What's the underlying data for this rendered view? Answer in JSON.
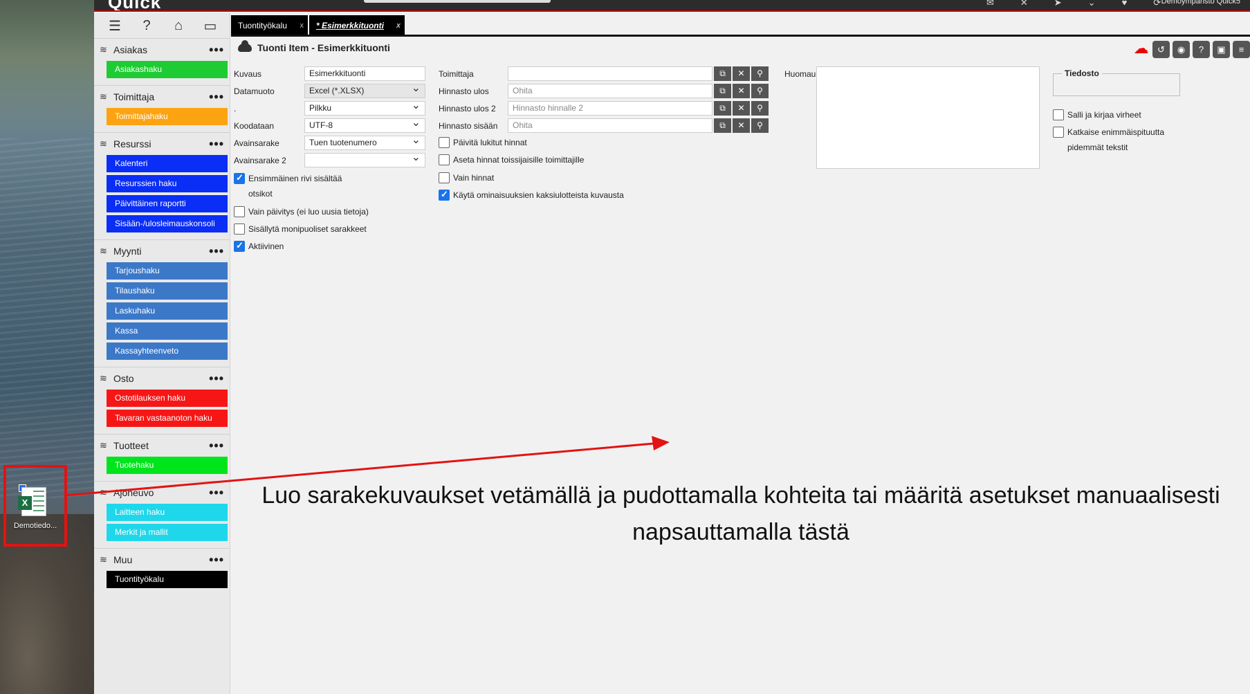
{
  "desktop": {
    "file_name": "Demotiedo..."
  },
  "topbar": {
    "logo": "Quick",
    "user": "Demoympäristö Quick5"
  },
  "nav": {
    "sections": [
      {
        "title": "Asiakas",
        "items": [
          {
            "label": "Asiakashaku",
            "color": "#1ecb32"
          }
        ]
      },
      {
        "title": "Toimittaja",
        "items": [
          {
            "label": "Toimittajahaku",
            "color": "#fca311"
          }
        ]
      },
      {
        "title": "Resurssi",
        "items": [
          {
            "label": "Kalenteri"
          },
          {
            "label": "Resurssien haku"
          },
          {
            "label": "Päivittäinen raportti"
          },
          {
            "label": "Sisään-/ulosleimauskonsoli"
          }
        ]
      },
      {
        "title": "Myynti",
        "items": [
          {
            "label": "Tarjoushaku"
          },
          {
            "label": "Tilaushaku"
          },
          {
            "label": "Laskuhaku"
          },
          {
            "label": "Kassa"
          },
          {
            "label": "Kassayhteenveto"
          }
        ]
      },
      {
        "title": "Osto",
        "items": [
          {
            "label": "Ostotilauksen haku"
          },
          {
            "label": "Tavaran vastaanoton haku"
          }
        ]
      },
      {
        "title": "Tuotteet",
        "items": [
          {
            "label": "Tuotehaku"
          }
        ]
      },
      {
        "title": "Ajoneuvo",
        "items": [
          {
            "label": "Laitteen haku"
          },
          {
            "label": "Merkit ja mallit"
          }
        ]
      },
      {
        "title": "Muu",
        "items": [
          {
            "label": "Tuontityökalu"
          }
        ]
      }
    ],
    "dots": "•••"
  },
  "tabs": [
    {
      "label": "Tuontityökalu",
      "close": "x"
    },
    {
      "label": "* Esimerkkituonti",
      "close": "x"
    }
  ],
  "page": {
    "title": "Tuonti Item - Esimerkkituonti"
  },
  "form": {
    "kuvaus_label": "Kuvaus",
    "kuvaus_value": "Esimerkkituonti",
    "datamuoto_label": "Datamuoto",
    "datamuoto_value": "Excel (*.XLSX)",
    "dot_label": ".",
    "dot_value": "Pilkku",
    "koodataan_label": "Koodataan",
    "koodataan_value": "UTF-8",
    "avainsarake_label": "Avainsarake",
    "avainsarake_value": "Tuen tuotenumero",
    "avainsarake2_label": "Avainsarake 2",
    "avainsarake2_value": "",
    "toimittaja_label": "Toimittaja",
    "hinnasto_ulos_label": "Hinnasto ulos",
    "hinnasto_ulos_ph": "Ohita",
    "hinnasto_ulos2_label": "Hinnasto ulos 2",
    "hinnasto_ulos2_ph": "Hinnasto hinnalle 2",
    "hinnasto_sisaan_label": "Hinnasto sisään",
    "hinnasto_sisaan_ph": "Ohita",
    "huomau_label": "Huomau",
    "tiedosto_label": "Tiedosto"
  },
  "checkboxes_left": [
    {
      "label": "Ensimmäinen rivi sisältää otsikot",
      "checked": true
    },
    {
      "label": "Vain päivitys (ei luo uusia tietoja)",
      "checked": false
    },
    {
      "label": "Sisällytä monipuoliset sarakkeet",
      "checked": false
    },
    {
      "label": "Aktiivinen",
      "checked": true
    }
  ],
  "checkboxes_mid": [
    {
      "label": "Päivitä lukitut hinnat",
      "checked": false
    },
    {
      "label": "Aseta hinnat toissijaisille toimittajille",
      "checked": false
    },
    {
      "label": "Vain hinnat",
      "checked": false
    },
    {
      "label": "Käytä ominaisuuksien kaksiulotteista kuvausta",
      "checked": true
    }
  ],
  "checkboxes_right": [
    {
      "label": "Salli ja kirjaa virheet",
      "checked": false
    },
    {
      "label": "Katkaise enimmäispituutta pidemmät tekstit",
      "checked": false
    }
  ],
  "hint": {
    "line1": "Luo sarakekuvaukset vetämällä ja pudottamalla kohteita tai määritä asetukset manuaalisesti",
    "line2": "napsauttamalla tästä"
  },
  "colors": {
    "accent_red": "#e21313",
    "sidebar_bg": "#e9e9e9"
  }
}
